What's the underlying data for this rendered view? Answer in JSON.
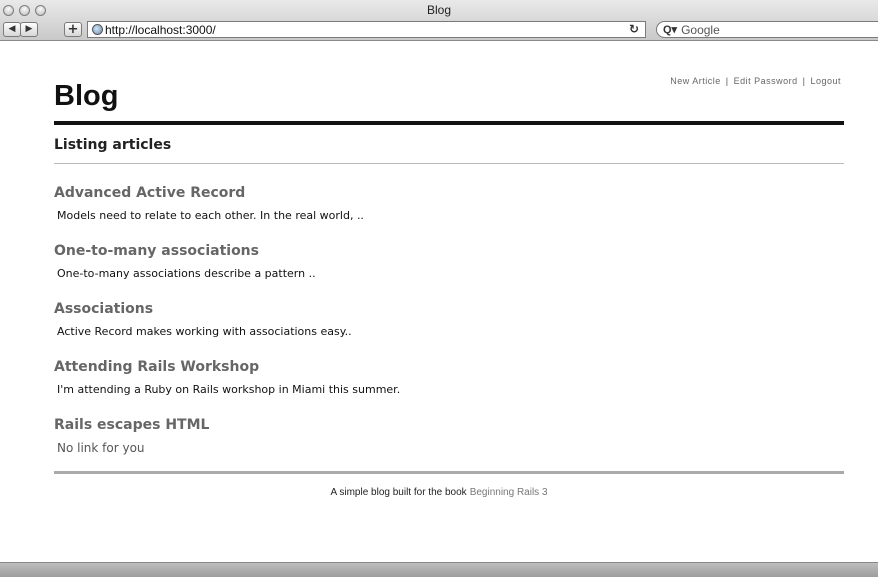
{
  "window": {
    "title": "Blog"
  },
  "toolbar": {
    "back_label": "◀",
    "forward_label": "▶",
    "add_label": "+",
    "url": "http://localhost:3000/",
    "reload_label": "↻",
    "search_icon": "Q▾",
    "search_placeholder": "Google"
  },
  "header": {
    "title": "Blog",
    "links": [
      "New Article",
      "Edit Password",
      "Logout"
    ],
    "separator": "|"
  },
  "main": {
    "heading": "Listing articles",
    "articles": [
      {
        "title": "Advanced Active Record",
        "body": "Models need to relate to each other. In the real world, .."
      },
      {
        "title": "One-to-many associations",
        "body": "One-to-many associations describe a pattern .."
      },
      {
        "title": "Associations",
        "body": "Active Record makes working with associations easy.."
      },
      {
        "title": "Attending Rails Workshop",
        "body": "I'm attending a Ruby on Rails workshop in Miami this summer."
      },
      {
        "title": "Rails escapes HTML",
        "body": "No link for you"
      }
    ]
  },
  "footer": {
    "text": "A simple blog built for the book",
    "link": "Beginning Rails 3"
  }
}
